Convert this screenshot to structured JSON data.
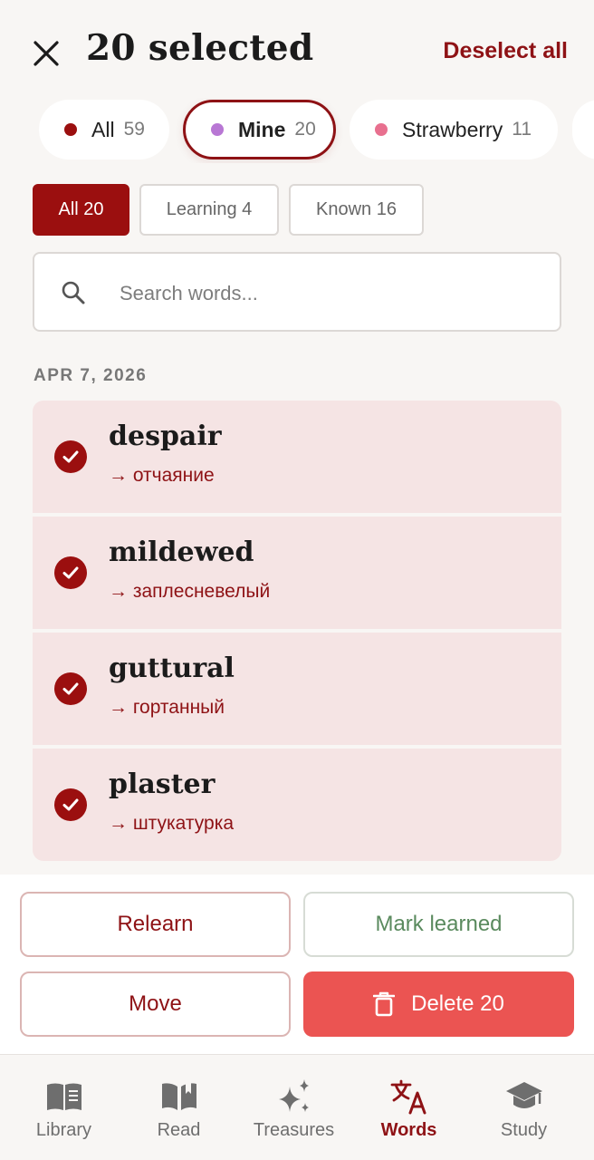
{
  "header": {
    "title": "20 selected",
    "deselect_label": "Deselect all"
  },
  "chips": [
    {
      "label": "All",
      "count": "59",
      "dot_color": "#9b0f0f",
      "active": false
    },
    {
      "label": "Mine",
      "count": "20",
      "dot_color": "#b877d4",
      "active": true
    },
    {
      "label": "Strawberry",
      "count": "11",
      "dot_color": "#e8708f",
      "active": false
    }
  ],
  "filters": [
    {
      "label": "All 20",
      "active": true
    },
    {
      "label": "Learning 4",
      "active": false
    },
    {
      "label": "Known 16",
      "active": false
    }
  ],
  "search": {
    "placeholder": "Search words..."
  },
  "date_header": "APR 7, 2026",
  "words": [
    {
      "word": "despair",
      "translation": "→ отчаяние",
      "selected": true
    },
    {
      "word": "mildewed",
      "translation": "→ заплесневелый",
      "selected": true
    },
    {
      "word": "guttural",
      "translation": "→ гортанный",
      "selected": true
    },
    {
      "word": "plaster",
      "translation": "→ штукатурка",
      "selected": true
    }
  ],
  "actions": {
    "relearn": "Relearn",
    "mark_learned": "Mark learned",
    "move": "Move",
    "delete": "Delete 20"
  },
  "nav": [
    {
      "label": "Library",
      "icon": "book-icon",
      "active": false
    },
    {
      "label": "Read",
      "icon": "open-book-icon",
      "active": false
    },
    {
      "label": "Treasures",
      "icon": "sparkle-icon",
      "active": false
    },
    {
      "label": "Words",
      "icon": "translate-icon",
      "active": true
    },
    {
      "label": "Study",
      "icon": "graduation-cap-icon",
      "active": false
    }
  ],
  "colors": {
    "accent": "#8e1215",
    "accent_fill": "#9b0f0f",
    "selected_row": "#f5e4e4",
    "delete": "#eb5452",
    "mark_learned": "#5a8a5e"
  }
}
